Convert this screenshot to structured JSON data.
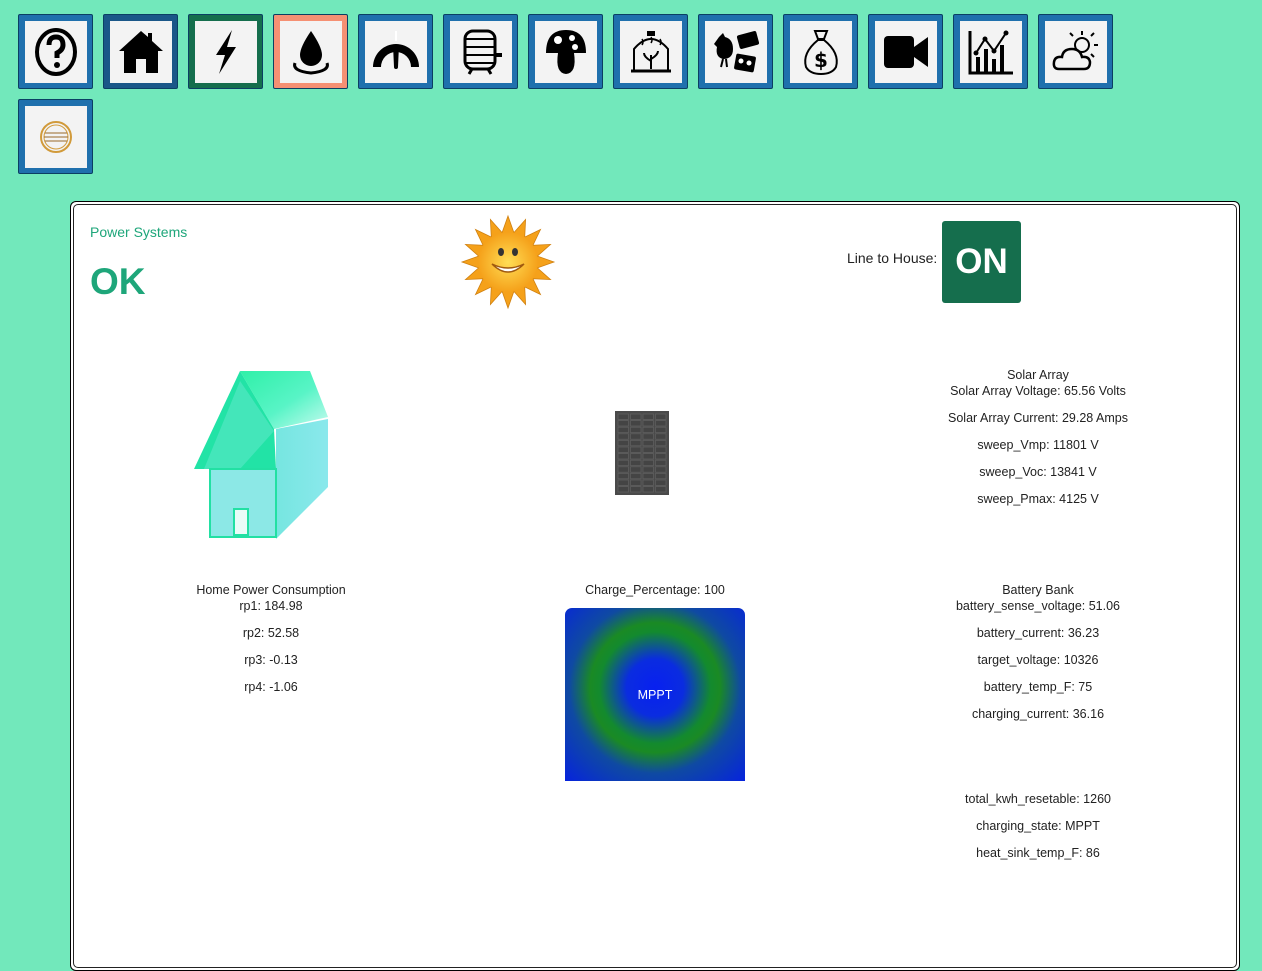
{
  "nav": [
    {
      "icon": "help-icon"
    },
    {
      "icon": "home-icon"
    },
    {
      "icon": "power-icon"
    },
    {
      "icon": "water-icon"
    },
    {
      "icon": "gauge-icon"
    },
    {
      "icon": "barrel-icon"
    },
    {
      "icon": "mushroom-icon"
    },
    {
      "icon": "greenhouse-icon"
    },
    {
      "icon": "chicken-eggs-icon"
    },
    {
      "icon": "money-bag-icon"
    },
    {
      "icon": "video-camera-icon"
    },
    {
      "icon": "chart-icon"
    },
    {
      "icon": "weather-icon"
    },
    {
      "icon": "logo-icon"
    }
  ],
  "panel": {
    "title": "Power Systems",
    "status": "OK",
    "line_label": "Line to House:",
    "line_state": "ON"
  },
  "solar": {
    "header": "Solar Array",
    "voltage": "Solar Array Voltage: 65.56 Volts",
    "current": "Solar Array Current: 29.28 Amps",
    "sweep_vmp": "sweep_Vmp: 11801 V",
    "sweep_voc": "sweep_Voc: 13841 V",
    "sweep_pmax": "sweep_Pmax: 4125 V"
  },
  "home": {
    "header": "Home Power Consumption",
    "rp1": "rp1: 184.98",
    "rp2": "rp2: 52.58",
    "rp3": "rp3: -0.13",
    "rp4": "rp4: -1.06"
  },
  "charge": {
    "label": "Charge_Percentage: 100",
    "mode": "MPPT"
  },
  "battery": {
    "header": "Battery Bank",
    "sense_voltage": "battery_sense_voltage: 51.06",
    "current": "battery_current: 36.23",
    "target_voltage": "target_voltage: 10326",
    "temp": "battery_temp_F: 75",
    "charging_current": "charging_current: 36.16"
  },
  "totals": {
    "kwh": "total_kwh_resetable: 1260",
    "state": "charging_state: MPPT",
    "heat_sink": "heat_sink_temp_F: 86"
  },
  "colors": {
    "background": "#72e8bb",
    "nav_blue": "#1f70ad",
    "power_green": "#156e4d",
    "water_orange": "#f59073",
    "status_green": "#1ea67a"
  }
}
